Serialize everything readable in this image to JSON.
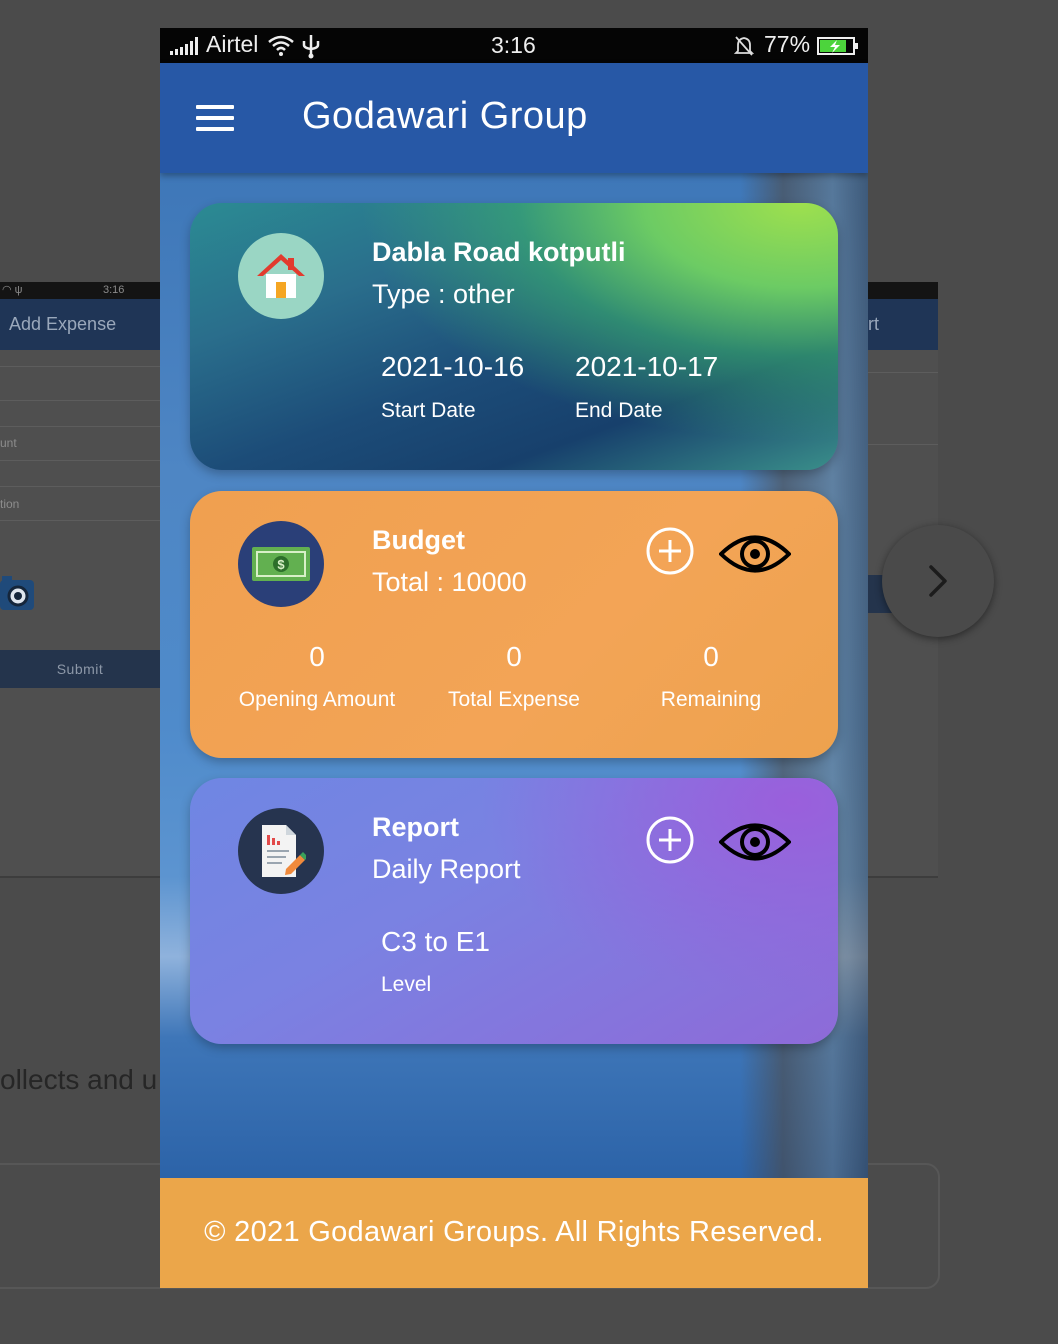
{
  "background": {
    "left_screen": {
      "status_time": "3:16",
      "header_title": "Add Expense",
      "field_label_1": "unt",
      "field_label_2": "tion",
      "submit_label": "Submit"
    },
    "right_screen": {
      "header_title": "rt"
    },
    "page_text": "ollects and u"
  },
  "status_bar": {
    "carrier": "Airtel",
    "time": "3:16",
    "battery": "77%"
  },
  "app_bar": {
    "title": "Godawari Group"
  },
  "site_card": {
    "title": "Dabla Road kotputli",
    "type": "Type : other",
    "start_date": "2021-10-16",
    "start_label": "Start Date",
    "end_date": "2021-10-17",
    "end_label": "End Date"
  },
  "budget_card": {
    "title": "Budget",
    "total": "Total : 10000",
    "opening_value": "0",
    "opening_label": "Opening Amount",
    "expense_value": "0",
    "expense_label": "Total Expense",
    "remaining_value": "0",
    "remaining_label": "Remaining"
  },
  "report_card": {
    "title": "Report",
    "subtitle": "Daily Report",
    "level_value": "C3 to E1",
    "level_label": "Level"
  },
  "footer": {
    "text": "© 2021 Godawari Groups. All Rights Reserved."
  },
  "colors": {
    "appbar": "#2758a6",
    "footer": "#eba64a",
    "budget_card": "#f3a456",
    "report_card": "#7a82e2"
  }
}
